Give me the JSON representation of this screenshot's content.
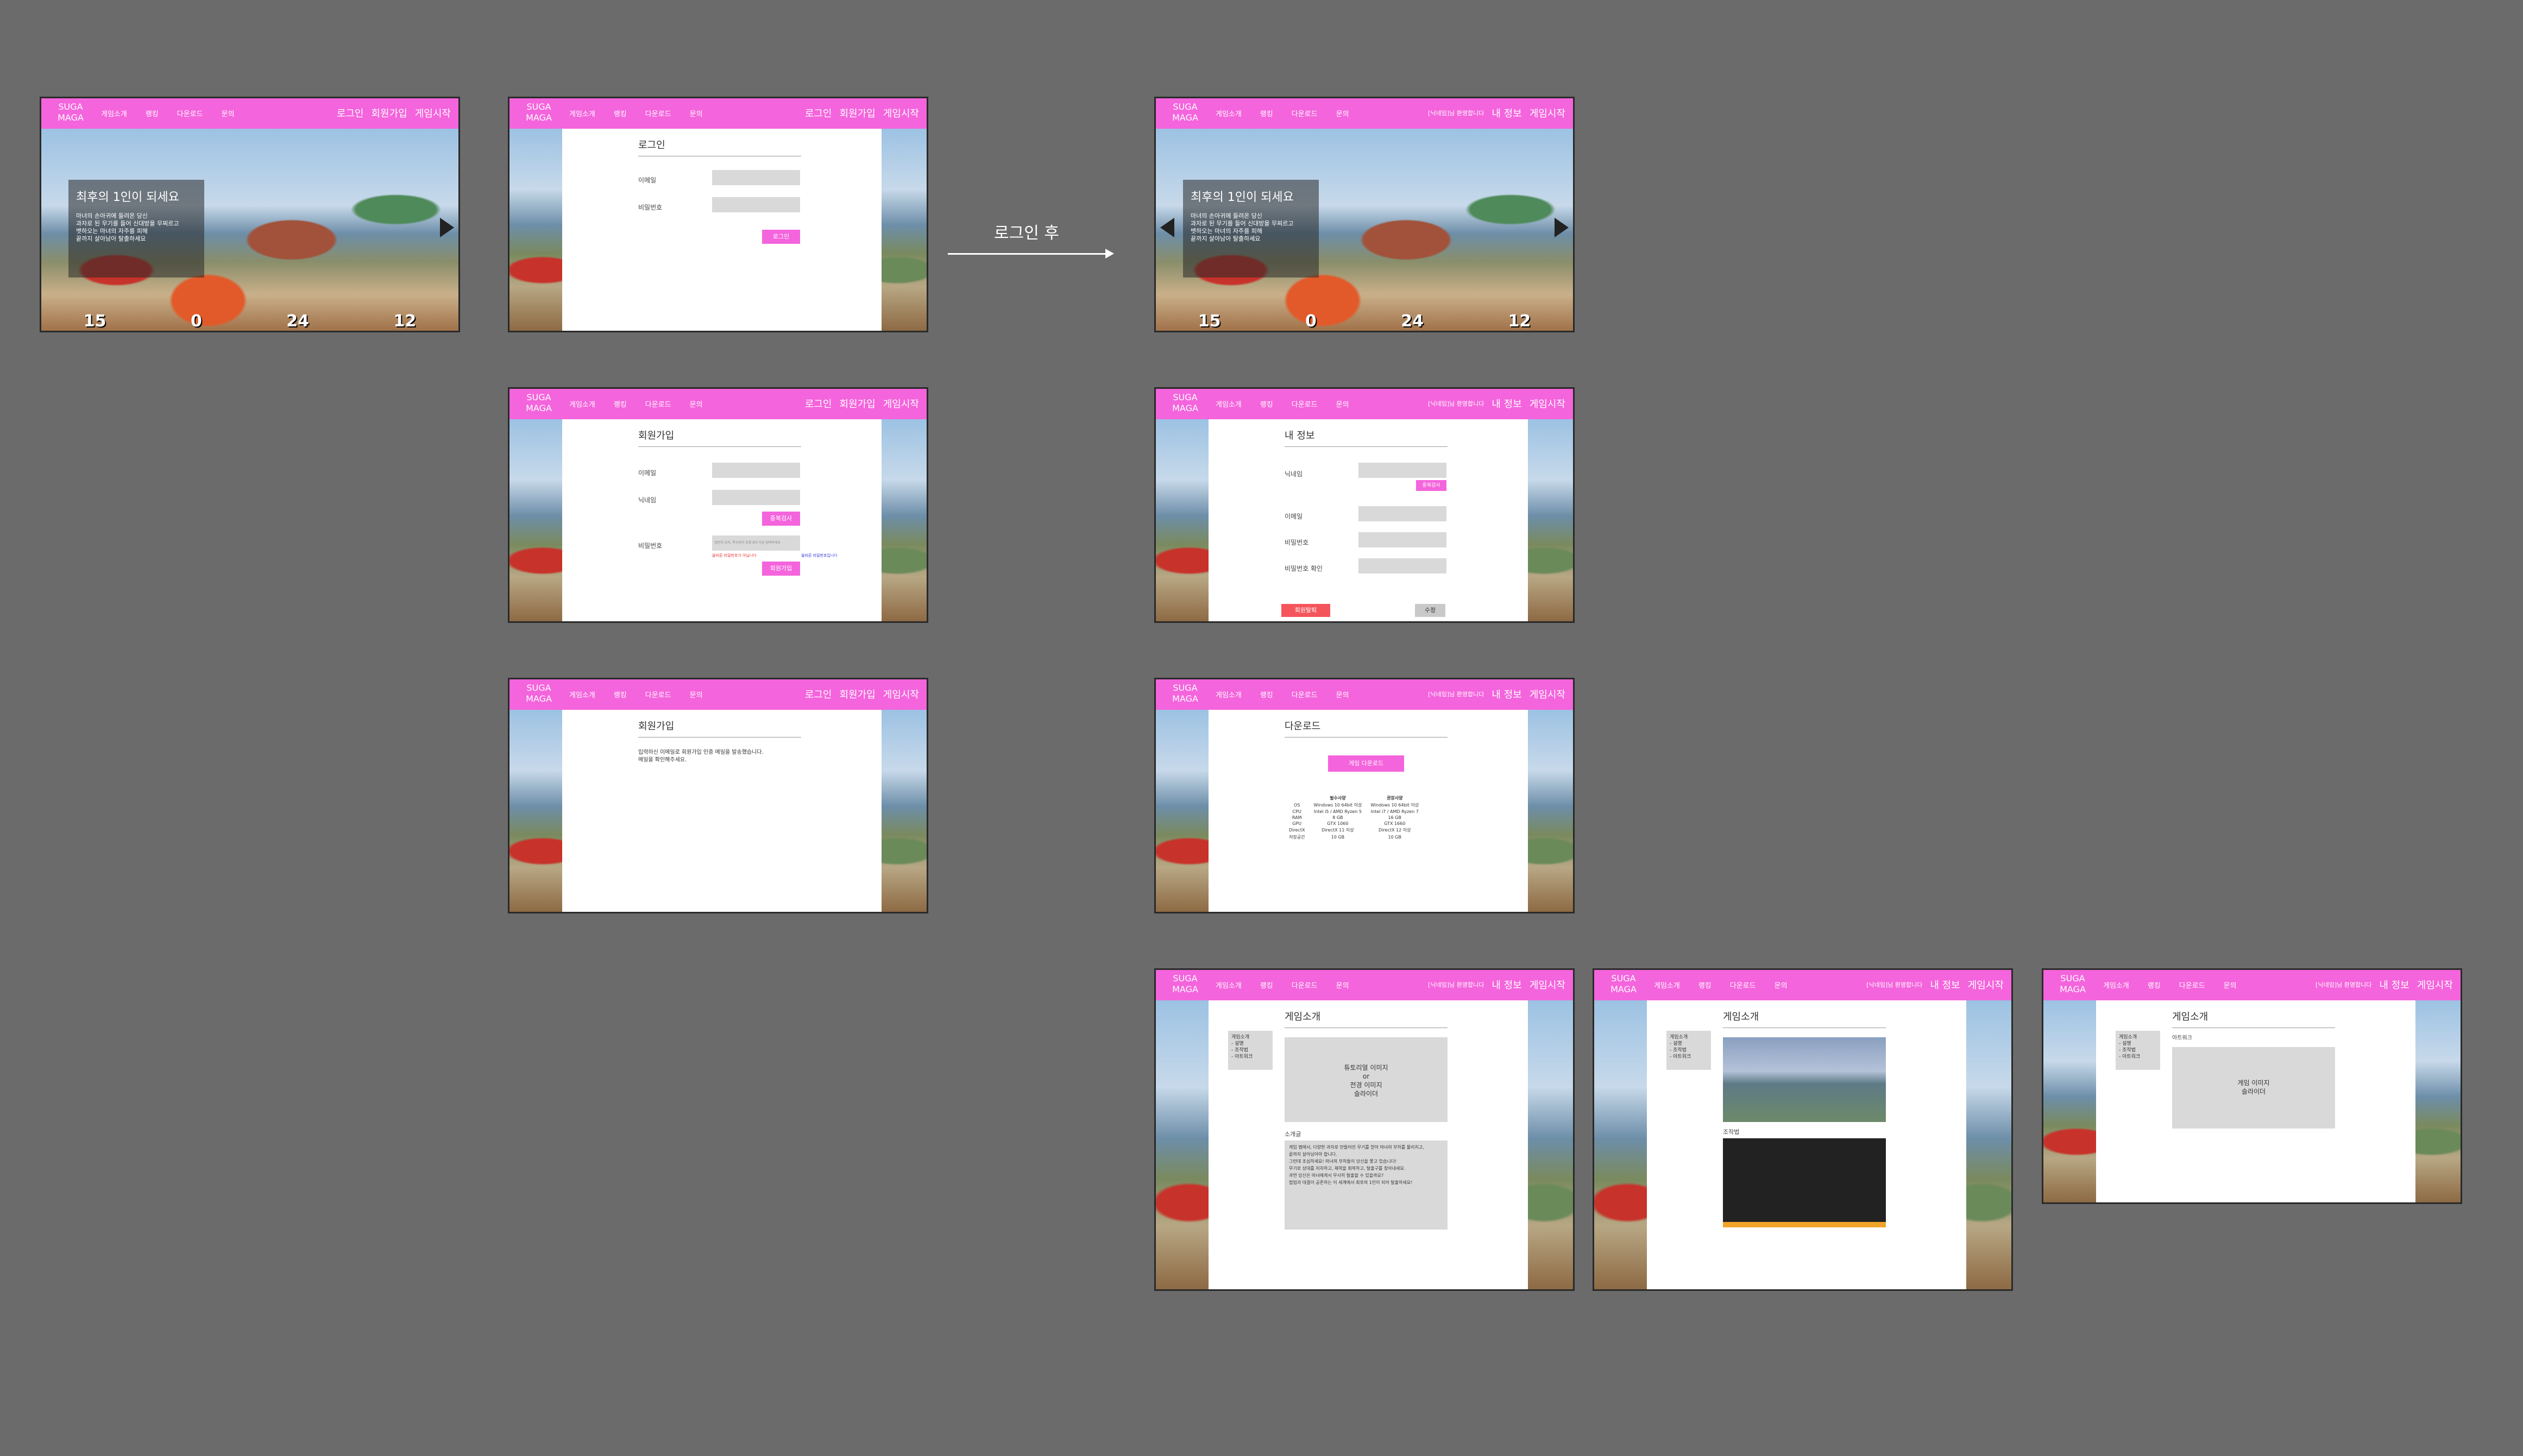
{
  "nav": {
    "logo": "SUGA\nMAGA",
    "menu": [
      "게임소개",
      "랭킹",
      "다운로드",
      "문의"
    ],
    "guest": [
      "로그인",
      "회원가입",
      "게임시작"
    ],
    "member": {
      "greeting": "[닉네임]님 환영합니다",
      "myinfo": "내 정보",
      "start": "게임시작"
    }
  },
  "annotation": "로그인 후",
  "home": {
    "hero_title": "최후의 1인이 되세요",
    "hero_body": [
      "마녀의 손아귀에 들려온 당신",
      "과자로 된 무기를 들어 신대방을 무찌르고",
      "뱃하오는 마녀의 자주를 피해",
      "끝까지 살아남아 탈출하세요"
    ],
    "scores": [
      "15",
      "0",
      "24",
      "12"
    ]
  },
  "login": {
    "title": "로그인",
    "email": "이메일",
    "password": "비밀번호",
    "button": "로그인"
  },
  "signup": {
    "title": "회원가입",
    "email": "이메일",
    "nickname": "닉네임",
    "check": "중복검사",
    "password": "비밀번호",
    "pw_ph": "영문자 숫자, 특수문자 포함 8자 이상 입력하세요",
    "warn": "올바른 비밀번호가 아닙니다",
    "ok": "올바른 비밀번호입니다",
    "button": "회원가입"
  },
  "signup_done": {
    "title": "회원가입",
    "msg1": "입력하신 이메일로 회원가입 인증 메일을 발송했습니다.",
    "msg2": "메일을 확인해주세요."
  },
  "myinfo": {
    "title": "내 정보",
    "nickname": "닉네임",
    "check": "중복검사",
    "email": "이메일",
    "password": "비밀번호",
    "password_confirm": "비밀번호 확인",
    "withdraw": "회원탈퇴",
    "edit": "수정"
  },
  "download": {
    "title": "다운로드",
    "button": "게임 다운로드",
    "cols": [
      "필수사양",
      "권장사양"
    ],
    "rows": [
      [
        "OS",
        "Windows 10 64bit 이상",
        "Windows 10 64bit 이상"
      ],
      [
        "CPU",
        "Intel i5 / AMD Ryzen 5",
        "Intel i7 / AMD Ryzen 7"
      ],
      [
        "RAM",
        "8 GB",
        "16 GB"
      ],
      [
        "GPU",
        "GTX 1060",
        "GTX 1660"
      ],
      [
        "DirectX",
        "DirectX 11 이상",
        "DirectX 12 이상"
      ],
      [
        "저장공간",
        "10 GB",
        "10 GB"
      ]
    ]
  },
  "intro": {
    "title": "게임소개",
    "side": [
      "게임소개",
      "- 설명",
      "- 조작법",
      "- 아트워크"
    ],
    "media": [
      "튜토리얼 이미지",
      "or",
      "전경 이미지",
      "슬라이더"
    ],
    "sub_intro": "소개글",
    "desc": [
      "게임 맵에서, 다양한 과자로 만들어진 무기를 얻어 마녀의 부하를 물리치고,",
      "끝까지 살아남아야 합니다.",
      "그런데 조심하세요! 마녀의 부하들이 당신을 쫓고 있습니다!",
      "무기로 상대를 처치하고, 체력을 회복하고, 탈출구를 찾아내세요.",
      "과연 당신은 마녀에게서 무사히 탈출할 수 있을까요?",
      "협업과 대결이 공존하는 이 세계에서 최후의 1인이 되어 탈출하세요!"
    ],
    "controls": "조작법",
    "artwork": "아트워크",
    "artwork_img": [
      "게임 이미지",
      "슬라이더"
    ]
  }
}
